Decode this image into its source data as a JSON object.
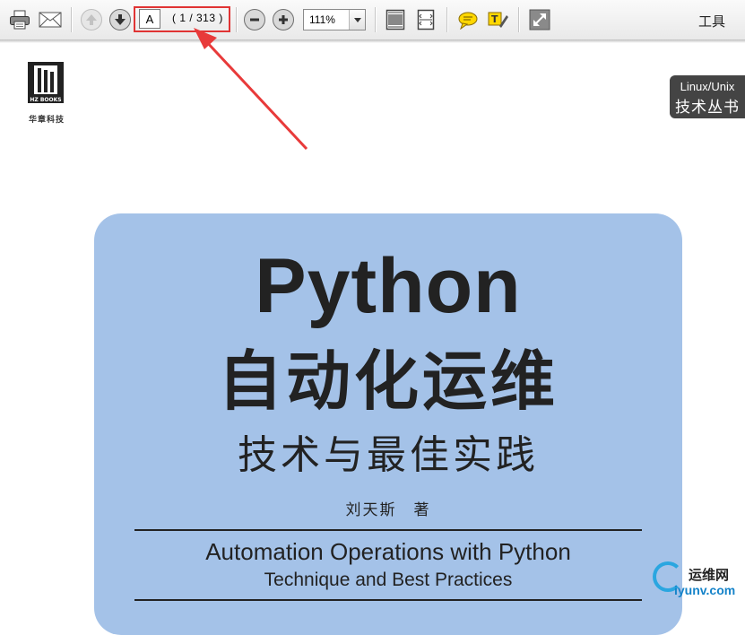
{
  "toolbar": {
    "page_input_value": "A",
    "page_count": "( 1 / 313 )",
    "zoom_value": "111%",
    "tools_label": "工具",
    "icons": [
      "print-icon",
      "email-icon",
      "previous-page-icon",
      "next-page-icon",
      "zoom-out-icon",
      "zoom-in-icon",
      "fit-page-icon",
      "fit-width-icon",
      "comment-icon",
      "highlight-text-icon",
      "fullscreen-icon"
    ]
  },
  "document": {
    "publisher_logo_text": "HZ BOOKS",
    "publisher_name": "华章科技",
    "series_line1": "Linux/Unix",
    "series_line2": "技术丛书",
    "title_en": "Python",
    "title_cn": "自动化运维",
    "subtitle_cn": "技术与最佳实践",
    "author": "刘天斯　著",
    "title_en_full": "Automation Operations with Python",
    "subtitle_en": "Technique and Best Practices"
  },
  "watermark": {
    "name_cn": "运维网",
    "domain": "iyunv.com"
  },
  "colors": {
    "cover_bg": "#a4c2e8",
    "highlight": "#e03434",
    "watermark_blue": "#1583c9"
  }
}
